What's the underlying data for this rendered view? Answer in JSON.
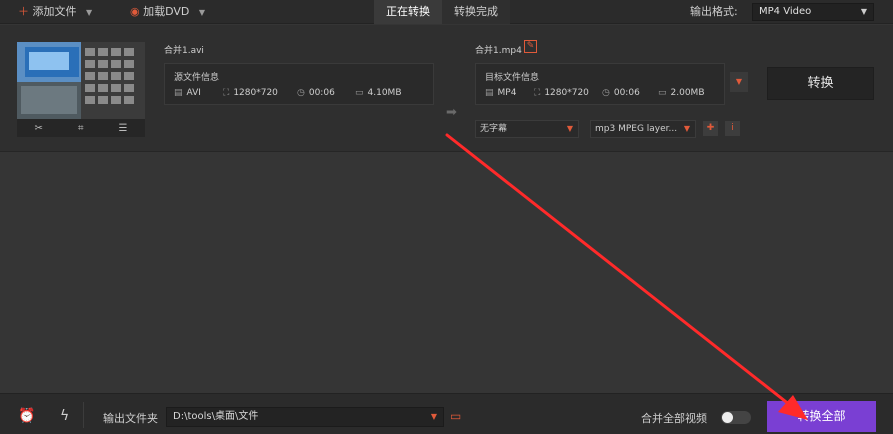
{
  "toolbar": {
    "add_file": "添加文件",
    "load_dvd": "加载DVD",
    "tab_converting": "正在转换",
    "tab_converted": "转换完成",
    "output_format_label": "输出格式:",
    "output_format_value": "MP4 Video"
  },
  "task": {
    "source_name": "合并1.avi",
    "source_info_title": "源文件信息",
    "source_format": "AVI",
    "source_resolution": "1280*720",
    "source_duration": "00:06",
    "source_size": "4.10MB",
    "target_name": "合并1.mp4",
    "target_info_title": "目标文件信息",
    "target_format": "MP4",
    "target_resolution": "1280*720",
    "target_duration": "00:06",
    "target_size": "2.00MB",
    "convert_label": "转换",
    "subtitle_value": "无字幕",
    "audio_value": "mp3 MPEG layer..."
  },
  "bottom": {
    "output_folder_label": "输出文件夹",
    "output_path": "D:\\tools\\桌面\\文件",
    "merge_label": "合并全部视频",
    "convert_all_label": "转换全部"
  },
  "colors": {
    "accent": "#e05a3a",
    "primary_button": "#7a3fd3",
    "annotation_arrow": "#ff2a2a"
  }
}
